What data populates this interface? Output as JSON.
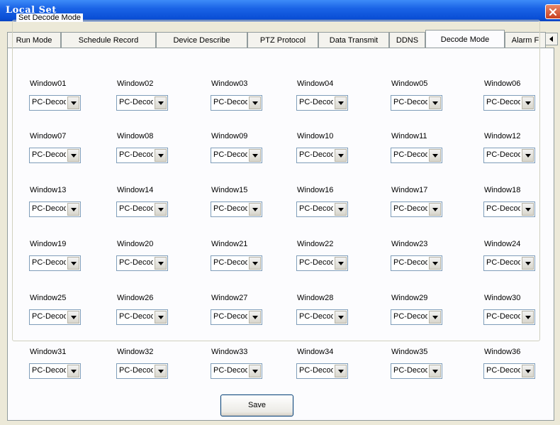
{
  "window": {
    "title": "Local Set"
  },
  "tabs": [
    {
      "label": "Run Mode"
    },
    {
      "label": "Schedule Record"
    },
    {
      "label": "Device Describe"
    },
    {
      "label": "PTZ Protocol"
    },
    {
      "label": "Data Transmit"
    },
    {
      "label": "DDNS"
    },
    {
      "label": "Decode Mode"
    },
    {
      "label": "Alarm F"
    }
  ],
  "active_tab": "Decode Mode",
  "group": {
    "title": "Set Decode Mode"
  },
  "windows": [
    {
      "label": "Window01",
      "value": "PC-Decode"
    },
    {
      "label": "Window02",
      "value": "PC-Decode"
    },
    {
      "label": "Window03",
      "value": "PC-Decode"
    },
    {
      "label": "Window04",
      "value": "PC-Decode"
    },
    {
      "label": "Window05",
      "value": "PC-Decode"
    },
    {
      "label": "Window06",
      "value": "PC-Decode"
    },
    {
      "label": "Window07",
      "value": "PC-Decode"
    },
    {
      "label": "Window08",
      "value": "PC-Decode"
    },
    {
      "label": "Window09",
      "value": "PC-Decode"
    },
    {
      "label": "Window10",
      "value": "PC-Decode"
    },
    {
      "label": "Window11",
      "value": "PC-Decode"
    },
    {
      "label": "Window12",
      "value": "PC-Decode"
    },
    {
      "label": "Window13",
      "value": "PC-Decode"
    },
    {
      "label": "Window14",
      "value": "PC-Decode"
    },
    {
      "label": "Window15",
      "value": "PC-Decode"
    },
    {
      "label": "Window16",
      "value": "PC-Decode"
    },
    {
      "label": "Window17",
      "value": "PC-Decode"
    },
    {
      "label": "Window18",
      "value": "PC-Decode"
    },
    {
      "label": "Window19",
      "value": "PC-Decode"
    },
    {
      "label": "Window20",
      "value": "PC-Decode"
    },
    {
      "label": "Window21",
      "value": "PC-Decode"
    },
    {
      "label": "Window22",
      "value": "PC-Decode"
    },
    {
      "label": "Window23",
      "value": "PC-Decode"
    },
    {
      "label": "Window24",
      "value": "PC-Decode"
    },
    {
      "label": "Window25",
      "value": "PC-Decode"
    },
    {
      "label": "Window26",
      "value": "PC-Decode"
    },
    {
      "label": "Window27",
      "value": "PC-Decode"
    },
    {
      "label": "Window28",
      "value": "PC-Decode"
    },
    {
      "label": "Window29",
      "value": "PC-Decode"
    },
    {
      "label": "Window30",
      "value": "PC-Decode"
    },
    {
      "label": "Window31",
      "value": "PC-Decode"
    },
    {
      "label": "Window32",
      "value": "PC-Decode"
    },
    {
      "label": "Window33",
      "value": "PC-Decode"
    },
    {
      "label": "Window34",
      "value": "PC-Decode"
    },
    {
      "label": "Window35",
      "value": "PC-Decode"
    },
    {
      "label": "Window36",
      "value": "PC-Decode"
    }
  ],
  "save_label": "Save",
  "icons": {
    "close": "close-icon",
    "tab_scroll_left": "arrow-left-icon",
    "tab_scroll_right": "arrow-right-icon",
    "dropdown": "chevron-down-icon"
  },
  "colors": {
    "titlebar": "#0a4fd6",
    "close_button": "#c8401f",
    "dialog_background": "#ece9d8"
  }
}
